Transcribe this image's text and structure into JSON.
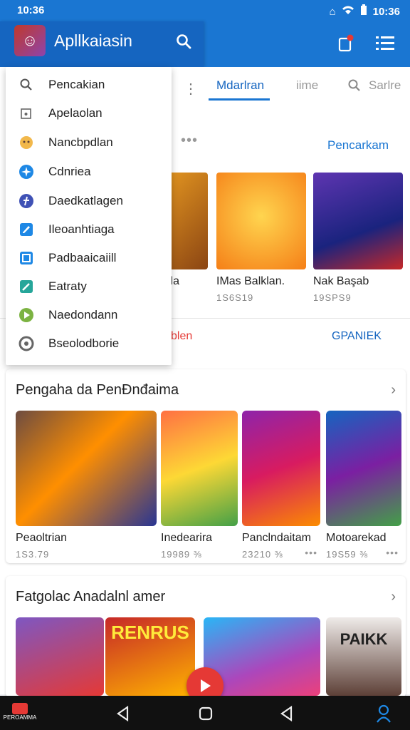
{
  "status": {
    "time": "10:36"
  },
  "header": {
    "title": "Apllkaiasin",
    "avatar_icon": "game-avatar-icon"
  },
  "tabs": [
    {
      "label": "Mdarlran",
      "active": true
    },
    {
      "label": "iime",
      "active": false
    },
    {
      "label": "Sarlre",
      "active": false
    }
  ],
  "link_pencarian": "Pencarkam",
  "top_cards": [
    {
      "name": "ila",
      "count": ""
    },
    {
      "name": "IMas Balklan.",
      "count": "1S6S19"
    },
    {
      "name": "Nak Başab",
      "count": "19SPS9"
    }
  ],
  "strip": {
    "red": "blen",
    "blue": "GPANIEK"
  },
  "dropdown": [
    {
      "label": "Pencakian",
      "icon": "search-icon"
    },
    {
      "label": "Apelaolan",
      "icon": "share-icon"
    },
    {
      "label": "Nancbpdlan",
      "icon": "character-icon"
    },
    {
      "label": "Cdnriea",
      "icon": "compass-icon"
    },
    {
      "label": "Daedkatlagen",
      "icon": "add-icon"
    },
    {
      "label": "Ileoanhtiaga",
      "icon": "edit-icon"
    },
    {
      "label": "Padbaaicaiill",
      "icon": "image-icon"
    },
    {
      "label": "Eatraty",
      "icon": "tool-icon"
    },
    {
      "label": "Naedondann",
      "icon": "play-icon"
    },
    {
      "label": "Bseolodborie",
      "icon": "settings-icon"
    }
  ],
  "section1": {
    "title": "Pengaha da PenĐnđaima",
    "cards": [
      {
        "name": "Peaoltrian",
        "count": "1S3.79"
      },
      {
        "name": "Inedearira",
        "count": "19989 ⅜"
      },
      {
        "name": "Panclndaitam",
        "count": "23210 ⅜"
      },
      {
        "name": "Motoarekad",
        "count": "19S59 ⅜"
      }
    ]
  },
  "section2": {
    "title": "Fatgolac Anadalnl amer",
    "banner_texts": [
      "RENRUS",
      "PAIKK"
    ]
  },
  "navbar": {
    "brand": "PEROAMMA"
  },
  "colors": {
    "primary": "#1a76d2",
    "accent_red": "#e53935"
  }
}
